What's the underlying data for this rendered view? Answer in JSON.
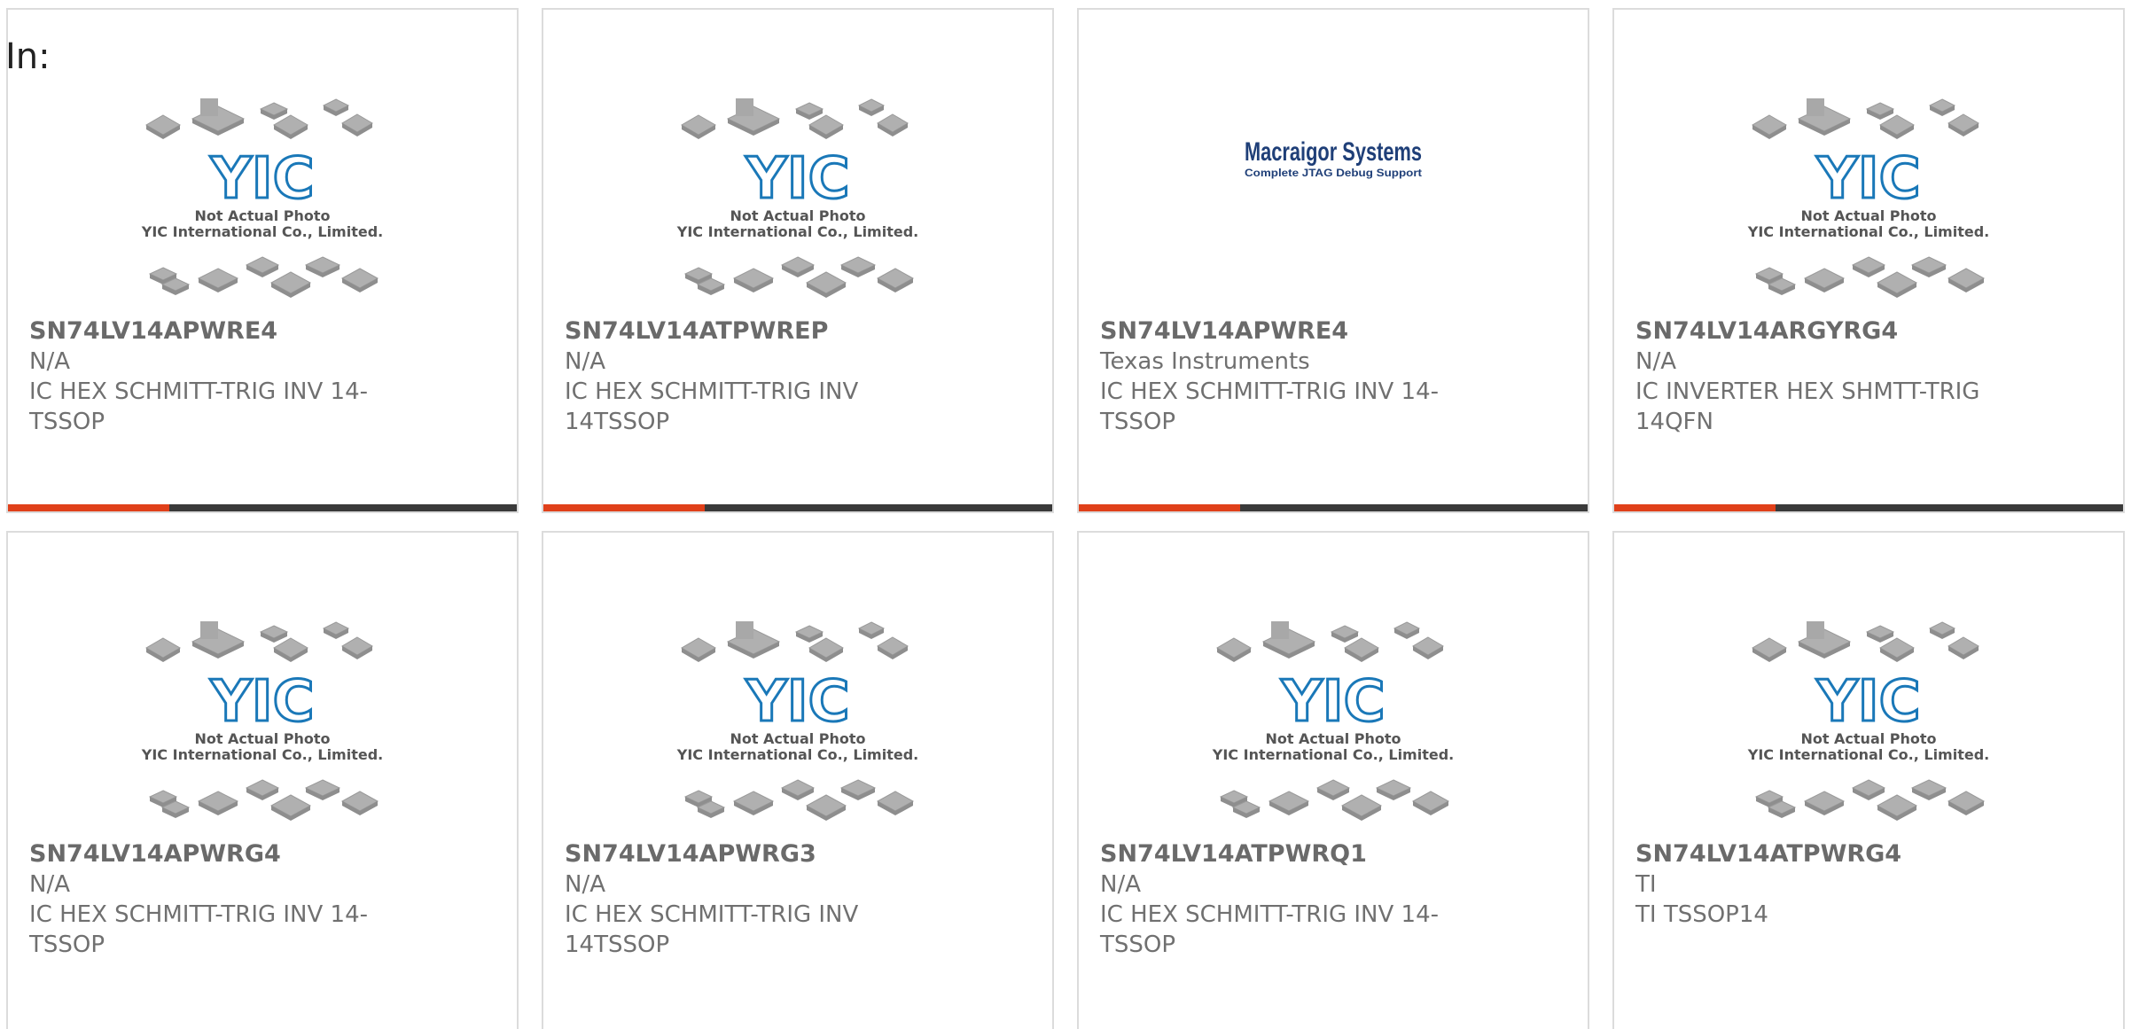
{
  "header": {
    "in_label": "In:"
  },
  "placeholder_image": {
    "brand": "YIC",
    "line1": "Not Actual Photo",
    "line2": "YIC International Co., Limited."
  },
  "macraigor_logo": {
    "line1": "Macraigor Systems",
    "line2": "Complete JTAG Debug Support"
  },
  "colors": {
    "accent": "#e0401a",
    "bar": "#3a3a3a",
    "logo_blue": "#1a78b8"
  },
  "products": [
    {
      "part": "SN74LV14APWRE4",
      "mfr": "N/A",
      "desc": "IC HEX SCHMITT-TRIG INV 14-TSSOP",
      "image": "yic-placeholder"
    },
    {
      "part": "SN74LV14ATPWREP",
      "mfr": "N/A",
      "desc": "IC HEX SCHMITT-TRIG INV 14TSSOP",
      "image": "yic-placeholder"
    },
    {
      "part": "SN74LV14APWRE4",
      "mfr": "Texas Instruments",
      "desc": "IC HEX SCHMITT-TRIG INV 14-TSSOP",
      "image": "macraigor-logo"
    },
    {
      "part": "SN74LV14ARGYRG4",
      "mfr": "N/A",
      "desc": "IC INVERTER HEX SHMTT-TRIG 14QFN",
      "image": "yic-placeholder"
    },
    {
      "part": "SN74LV14APWRG4",
      "mfr": "N/A",
      "desc": "IC HEX SCHMITT-TRIG INV 14-TSSOP",
      "image": "yic-placeholder"
    },
    {
      "part": "SN74LV14APWRG3",
      "mfr": "N/A",
      "desc": "IC HEX SCHMITT-TRIG INV 14TSSOP",
      "image": "yic-placeholder"
    },
    {
      "part": "SN74LV14ATPWRQ1",
      "mfr": "N/A",
      "desc": "IC HEX SCHMITT-TRIG INV 14-TSSOP",
      "image": "yic-placeholder"
    },
    {
      "part": "SN74LV14ATPWRG4",
      "mfr": "TI",
      "desc": "TI TSSOP14",
      "image": "yic-placeholder"
    }
  ]
}
